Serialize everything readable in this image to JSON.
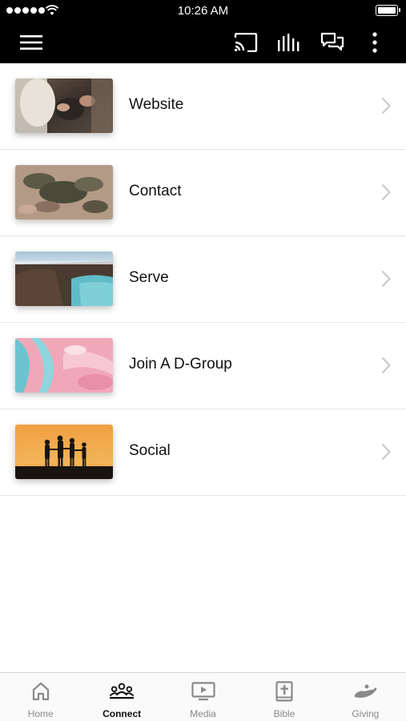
{
  "status_bar": {
    "time": "10:26 AM"
  },
  "nav_bar": {
    "icons": [
      "menu-icon",
      "cast-icon",
      "audio-bars-icon",
      "chat-icon",
      "more-vertical-icon"
    ],
    "background": "#000000"
  },
  "list": {
    "items": [
      {
        "label": "Website",
        "image": "people-hands-photo"
      },
      {
        "label": "Contact",
        "image": "aerial-terrain-photo"
      },
      {
        "label": "Serve",
        "image": "crater-lake-photo"
      },
      {
        "label": "Join A D-Group",
        "image": "pink-marble-photo"
      },
      {
        "label": "Social",
        "image": "sunset-silhouettes-photo"
      }
    ]
  },
  "tab_bar": {
    "tabs": [
      {
        "label": "Home",
        "icon": "home-icon",
        "active": false
      },
      {
        "label": "Connect",
        "icon": "people-icon",
        "active": true
      },
      {
        "label": "Media",
        "icon": "play-screen-icon",
        "active": false
      },
      {
        "label": "Bible",
        "icon": "bible-icon",
        "active": false
      },
      {
        "label": "Giving",
        "icon": "giving-hand-icon",
        "active": false
      }
    ],
    "active_color": "#111111",
    "inactive_color": "#8a8a8a"
  }
}
